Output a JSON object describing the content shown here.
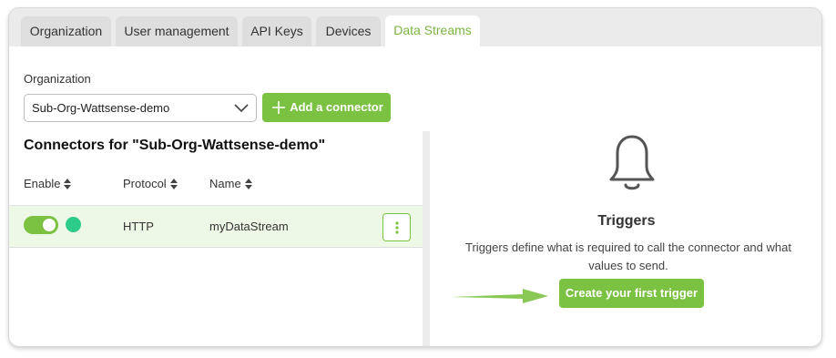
{
  "tabs": [
    {
      "label": "Organization",
      "active": false
    },
    {
      "label": "User management",
      "active": false
    },
    {
      "label": "API Keys",
      "active": false
    },
    {
      "label": "Devices",
      "active": false
    },
    {
      "label": "Data Streams",
      "active": true
    }
  ],
  "org": {
    "label": "Organization",
    "selected": "Sub-Org-Wattsense-demo",
    "add_button": "Add a connector"
  },
  "connectors": {
    "title": "Connectors for \"Sub-Org-Wattsense-demo\"",
    "columns": {
      "enable": "Enable",
      "protocol": "Protocol",
      "name": "Name"
    },
    "rows": [
      {
        "enabled": true,
        "status": "active",
        "protocol": "HTTP",
        "name": "myDataStream"
      }
    ]
  },
  "triggers": {
    "icon": "bell-icon",
    "title": "Triggers",
    "description": "Triggers define what is required to call the connector and what values to send.",
    "button": "Create your first trigger"
  },
  "colors": {
    "accent": "#7cc242",
    "active_tab": "#7cb342",
    "status_active": "#2ecc8a",
    "row_highlight": "#eef8e6"
  }
}
